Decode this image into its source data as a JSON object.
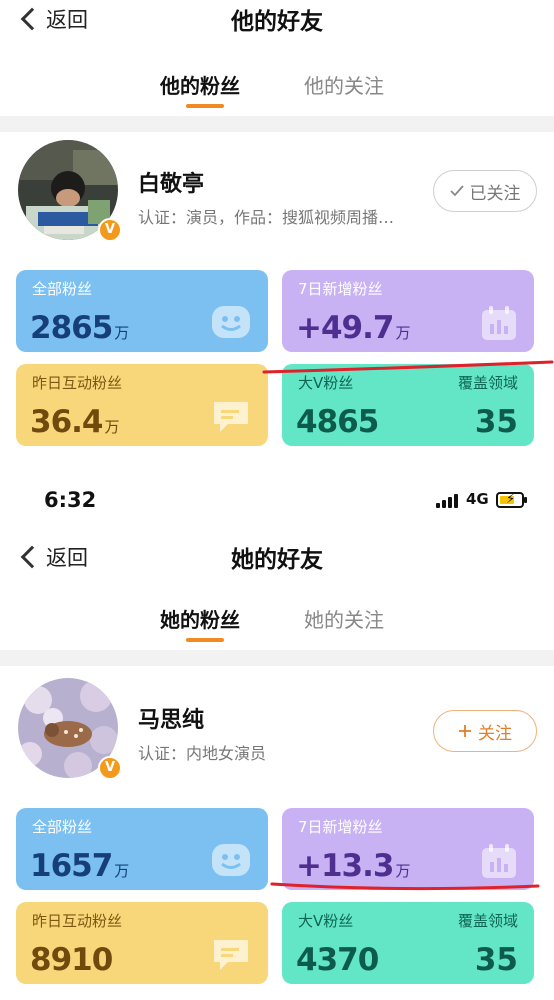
{
  "screens": [
    {
      "nav": {
        "back_label": "返回",
        "title": "他的好友"
      },
      "tabs": [
        {
          "label": "他的粉丝",
          "active": true
        },
        {
          "label": "他的关注",
          "active": false
        }
      ],
      "profile": {
        "name": "白敬亭",
        "verification": "认证：演员，作品：搜狐视频周播…",
        "badge": "V",
        "follow_button": {
          "icon": "check-icon",
          "label": "已关注"
        }
      },
      "stats": {
        "total_fans": {
          "label": "全部粉丝",
          "value": "2865",
          "unit": "万"
        },
        "new_fans_7d": {
          "label": "7日新增粉丝",
          "value": "+49.7",
          "unit": "万"
        },
        "yesterday_interactive": {
          "label": "昨日互动粉丝",
          "value": "36.4",
          "unit": "万"
        },
        "big_v": {
          "label": "大V粉丝",
          "value": "4865",
          "coverage_label": "覆盖领域",
          "coverage_value": "35"
        }
      }
    },
    {
      "status_bar": {
        "time": "6:32",
        "network": "4G"
      },
      "nav": {
        "back_label": "返回",
        "title": "她的好友"
      },
      "tabs": [
        {
          "label": "她的粉丝",
          "active": true
        },
        {
          "label": "她的关注",
          "active": false
        }
      ],
      "profile": {
        "name": "马思纯",
        "verification": "认证：内地女演员",
        "badge": "V",
        "follow_button": {
          "icon": "plus-icon",
          "label": "关注"
        }
      },
      "stats": {
        "total_fans": {
          "label": "全部粉丝",
          "value": "1657",
          "unit": "万"
        },
        "new_fans_7d": {
          "label": "7日新增粉丝",
          "value": "+13.3",
          "unit": "万"
        },
        "yesterday_interactive": {
          "label": "昨日互动粉丝",
          "value": "8910"
        },
        "big_v": {
          "label": "大V粉丝",
          "value": "4370",
          "coverage_label": "覆盖领域",
          "coverage_value": "35"
        }
      }
    }
  ],
  "colors": {
    "accent_orange": "#f08a24",
    "card_blue": "#7cc0f2",
    "card_purple": "#c8b2f4",
    "card_yellow": "#f8d77a",
    "card_green": "#63e6c6",
    "annotation_red": "#e0212b"
  }
}
